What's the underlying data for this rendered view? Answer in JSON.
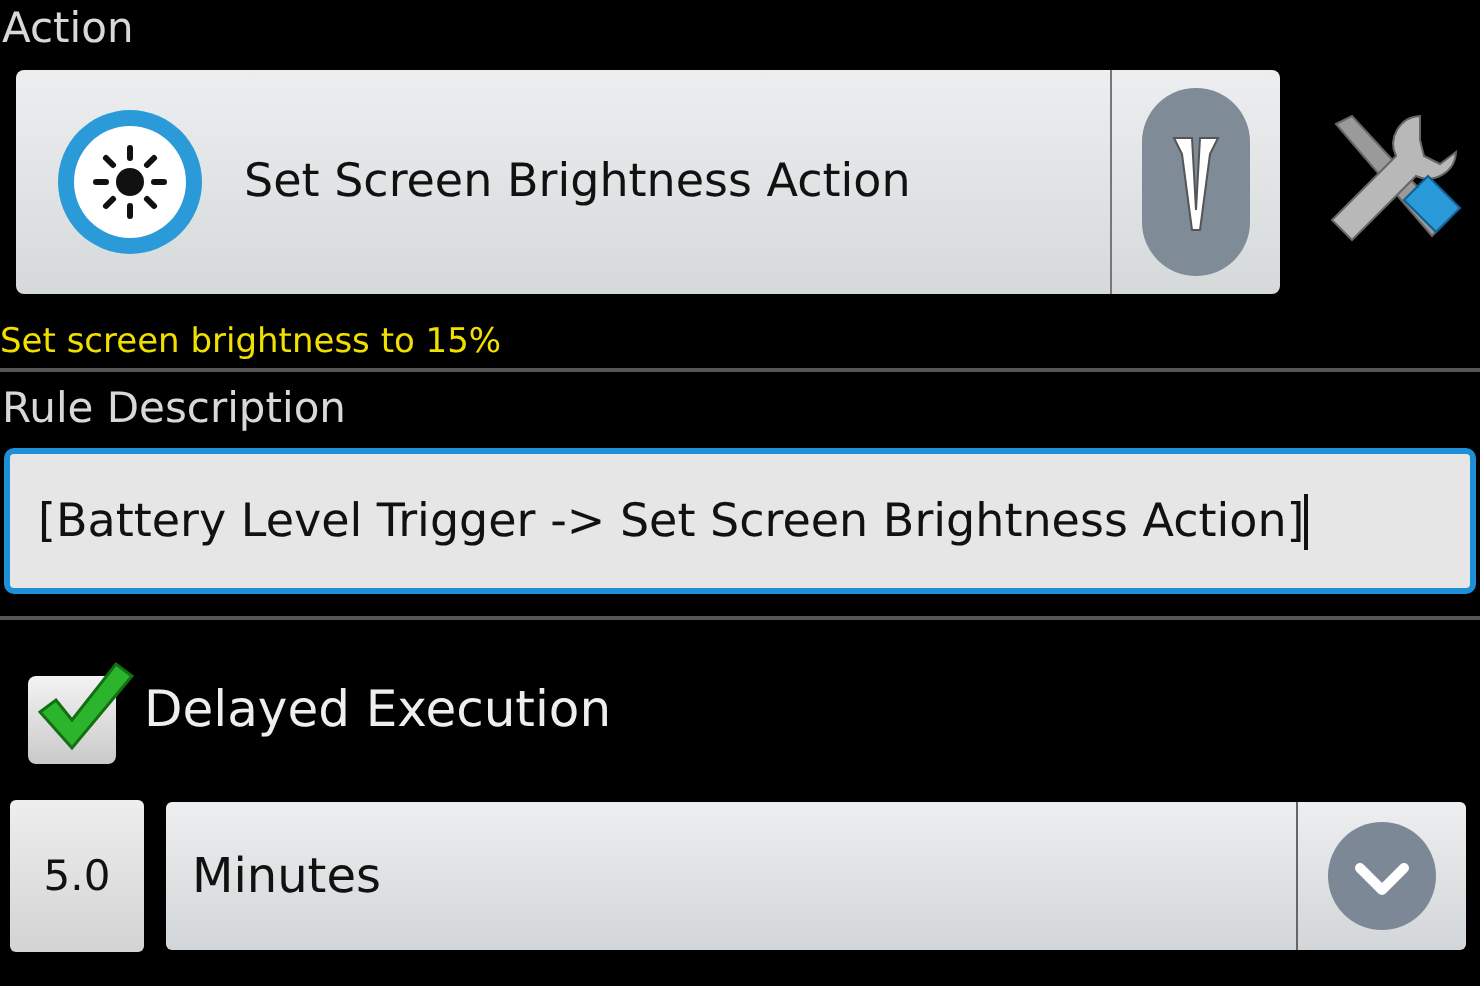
{
  "action": {
    "label": "Action",
    "name": "Set Screen Brightness Action",
    "summary": "Set screen brightness to 15%"
  },
  "rule_description": {
    "label": "Rule Description",
    "value": "[Battery Level Trigger -> Set Screen Brightness Action]",
    "focused": true
  },
  "delayed_execution": {
    "label": "Delayed Execution",
    "checked": true
  },
  "delay": {
    "amount": "5.0",
    "unit": "Minutes"
  }
}
